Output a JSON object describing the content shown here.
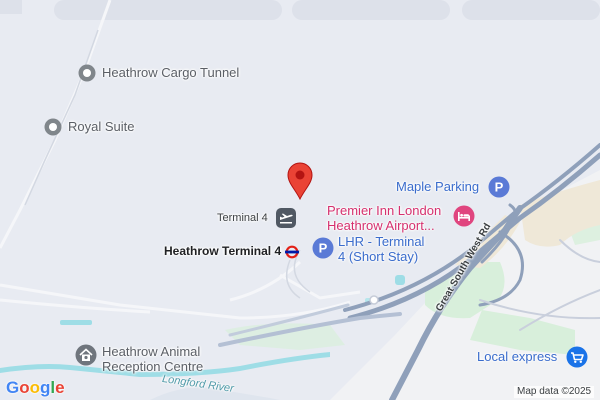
{
  "places": {
    "cargo_tunnel": "Heathrow Cargo Tunnel",
    "royal_suite": "Royal Suite",
    "terminal4": "Terminal 4",
    "heathrow_t4_station": "Heathrow Terminal 4",
    "maple_parking": "Maple Parking",
    "premier_inn_line1": "Premier Inn London",
    "premier_inn_line2": "Heathrow Airport...",
    "lhr_parking_line1": "LHR - Terminal",
    "lhr_parking_line2": "4 (Short Stay)",
    "animal_centre_line1": "Heathrow Animal",
    "animal_centre_line2": "Reception Centre",
    "local_express": "Local express"
  },
  "roads": {
    "great_south_west_rd": "Great South West Rd"
  },
  "water": {
    "longford_river": "Longford River"
  },
  "attribution": {
    "logo": "Google",
    "map_data": "Map data ©2025"
  },
  "icons": {
    "pin": "location-pin-icon",
    "parking": "parking-icon",
    "hotel": "hotel-icon",
    "airport": "airport-departure-icon",
    "underground": "underground-station-icon",
    "pet": "pet-icon",
    "shopping": "shopping-cart-icon",
    "poi": "poi-dot-icon"
  },
  "colors": {
    "land": "#e8ebf2",
    "road": "#8fa0ba",
    "green": "#d9f0dd",
    "water": "#9edde6",
    "pin": "#ea4335",
    "parking": "#5a7ad6",
    "hotel": "#e0457f",
    "shopping": "#1a73e8"
  }
}
